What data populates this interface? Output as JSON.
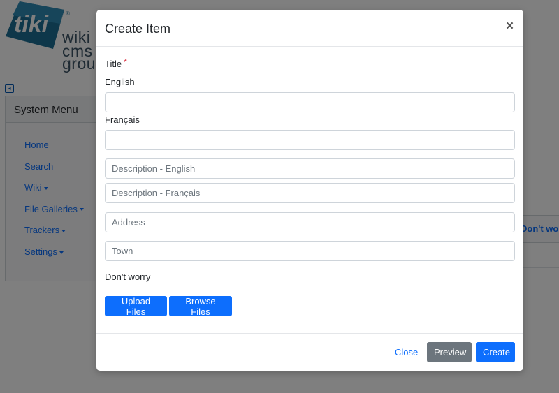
{
  "logo": {
    "mark_text": "tiki",
    "line1": "wiki",
    "line2": "cms",
    "line3": "group"
  },
  "system_menu": {
    "title": "System Menu",
    "items": [
      {
        "label": "Home",
        "has_caret": false
      },
      {
        "label": "Search",
        "has_caret": false
      },
      {
        "label": "Wiki",
        "has_caret": true
      },
      {
        "label": "File Galleries",
        "has_caret": true
      },
      {
        "label": "Trackers",
        "has_caret": true
      },
      {
        "label": "Settings",
        "has_caret": true
      }
    ]
  },
  "background_right_text": "Don't worry",
  "modal": {
    "title": "Create Item",
    "close_glyph": "×",
    "title_label": "Title",
    "required_mark": "*",
    "lang_english": "English",
    "lang_french": "Français",
    "title_en_value": "",
    "title_fr_value": "",
    "desc_en_placeholder": "Description - English",
    "desc_fr_placeholder": "Description - Français",
    "address_placeholder": "Address",
    "town_placeholder": "Town",
    "note_text": "Don't worry",
    "upload_label": "Upload Files",
    "browse_label": "Browse Files",
    "footer": {
      "close_label": "Close",
      "preview_label": "Preview",
      "create_label": "Create"
    }
  },
  "colors": {
    "primary": "#0d6efd",
    "secondary": "#6c757d",
    "required": "#dc3545",
    "logo_blue": "#1d6f95"
  }
}
